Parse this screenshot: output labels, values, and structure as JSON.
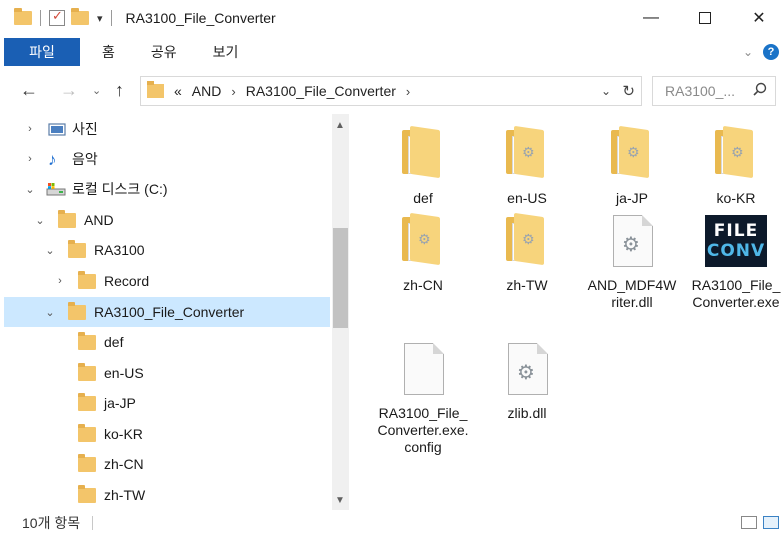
{
  "window": {
    "title": "RA3100_File_Converter",
    "minimize_glyph": "—",
    "close_glyph": "✕"
  },
  "ribbon": {
    "file_tab": "파일",
    "tabs": [
      "홈",
      "공유",
      "보기"
    ],
    "help": "?"
  },
  "nav": {
    "back": "←",
    "forward": "→",
    "recent": "⌄",
    "up": "↑"
  },
  "address": {
    "overflow": "«",
    "crumbs": [
      "AND",
      "RA3100_File_Converter"
    ],
    "separator": "›"
  },
  "search": {
    "placeholder": "RA3100_..."
  },
  "tree": [
    {
      "label": "사진",
      "icon": "pictures-icon",
      "expand": "›"
    },
    {
      "label": "음악",
      "icon": "music-icon",
      "expand": "›"
    },
    {
      "label": "로컬 디스크 (C:)",
      "icon": "drive-icon",
      "expand": "⌄"
    },
    {
      "label": "AND",
      "icon": "folder-icon",
      "expand": "⌄"
    },
    {
      "label": "RA3100",
      "icon": "folder-icon",
      "expand": "⌄"
    },
    {
      "label": "Record",
      "icon": "folder-icon",
      "expand": "›"
    },
    {
      "label": "RA3100_File_Converter",
      "icon": "folder-icon",
      "expand": "⌄",
      "selected": true
    },
    {
      "label": "def",
      "icon": "folder-icon",
      "expand": ""
    },
    {
      "label": "en-US",
      "icon": "folder-icon",
      "expand": ""
    },
    {
      "label": "ja-JP",
      "icon": "folder-icon",
      "expand": ""
    },
    {
      "label": "ko-KR",
      "icon": "folder-icon",
      "expand": ""
    },
    {
      "label": "zh-CN",
      "icon": "folder-icon",
      "expand": ""
    },
    {
      "label": "zh-TW",
      "icon": "folder-icon",
      "expand": ""
    }
  ],
  "files": [
    {
      "name": "def",
      "type": "folder"
    },
    {
      "name": "en-US",
      "type": "folder"
    },
    {
      "name": "ja-JP",
      "type": "folder"
    },
    {
      "name": "ko-KR",
      "type": "folder"
    },
    {
      "name": "zh-CN",
      "type": "folder"
    },
    {
      "name": "zh-TW",
      "type": "folder"
    },
    {
      "name": "AND_MDF4Writer.dll",
      "type": "dll"
    },
    {
      "name": "RA3100_File_Converter.exe",
      "type": "exe",
      "icon_text": [
        "FILE",
        "CONV"
      ]
    },
    {
      "name": "RA3100_File_Converter.exe.config",
      "type": "config"
    },
    {
      "name": "zlib.dll",
      "type": "dll"
    }
  ],
  "status": {
    "item_count": "10개 항목"
  },
  "colors": {
    "accent": "#1a5fb4",
    "selection": "#cce8ff",
    "folder": "#f3c56a"
  }
}
